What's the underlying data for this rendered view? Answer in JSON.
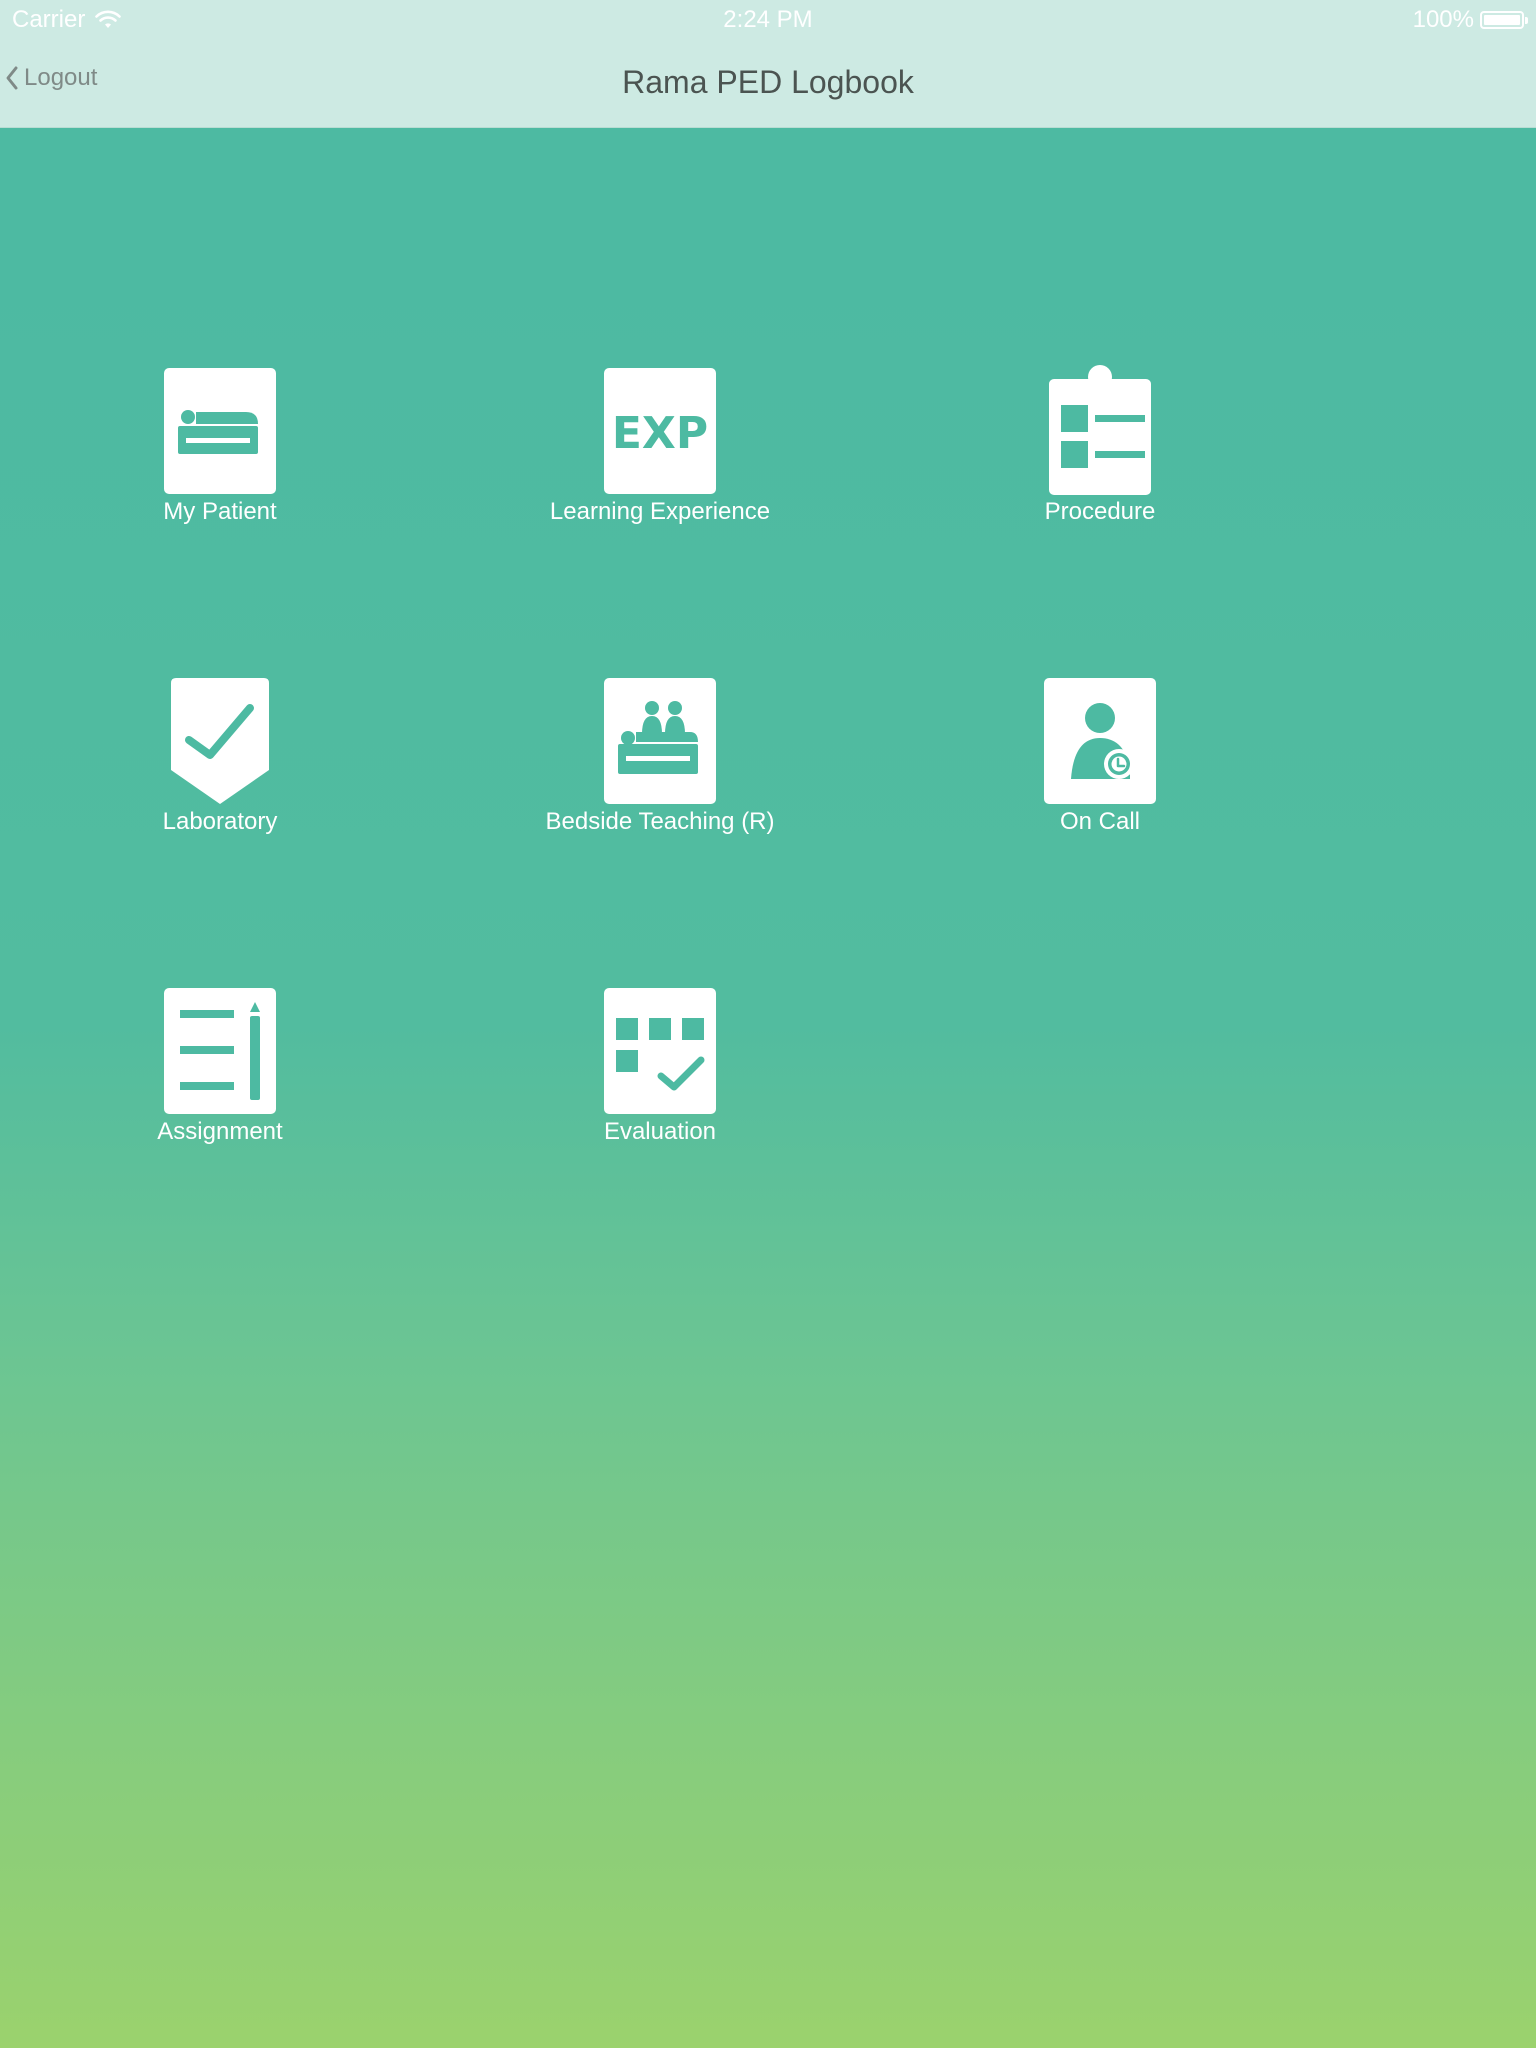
{
  "status_bar": {
    "carrier": "Carrier",
    "time": "2:24 PM",
    "battery": "100%"
  },
  "nav": {
    "back_label": "Logout",
    "title": "Rama PED Logbook"
  },
  "colors": {
    "accent": "#4dbaa2",
    "bar_background": "#cdeae3",
    "tile_icon_bg": "#ffffff",
    "gradient_bottom": "#9bd26d"
  },
  "menu": {
    "items": [
      {
        "label": "My Patient",
        "icon": "bed-icon"
      },
      {
        "label": "Learning Experience",
        "icon": "exp-icon",
        "icon_text": "EXP"
      },
      {
        "label": "Procedure",
        "icon": "clipboard-icon"
      },
      {
        "label": "Laboratory",
        "icon": "shield-check-icon"
      },
      {
        "label": "Bedside Teaching (R)",
        "icon": "bedside-teaching-icon"
      },
      {
        "label": "On Call",
        "icon": "person-clock-icon"
      },
      {
        "label": "Assignment",
        "icon": "document-pencil-icon"
      },
      {
        "label": "Evaluation",
        "icon": "evaluation-grid-icon"
      }
    ]
  }
}
